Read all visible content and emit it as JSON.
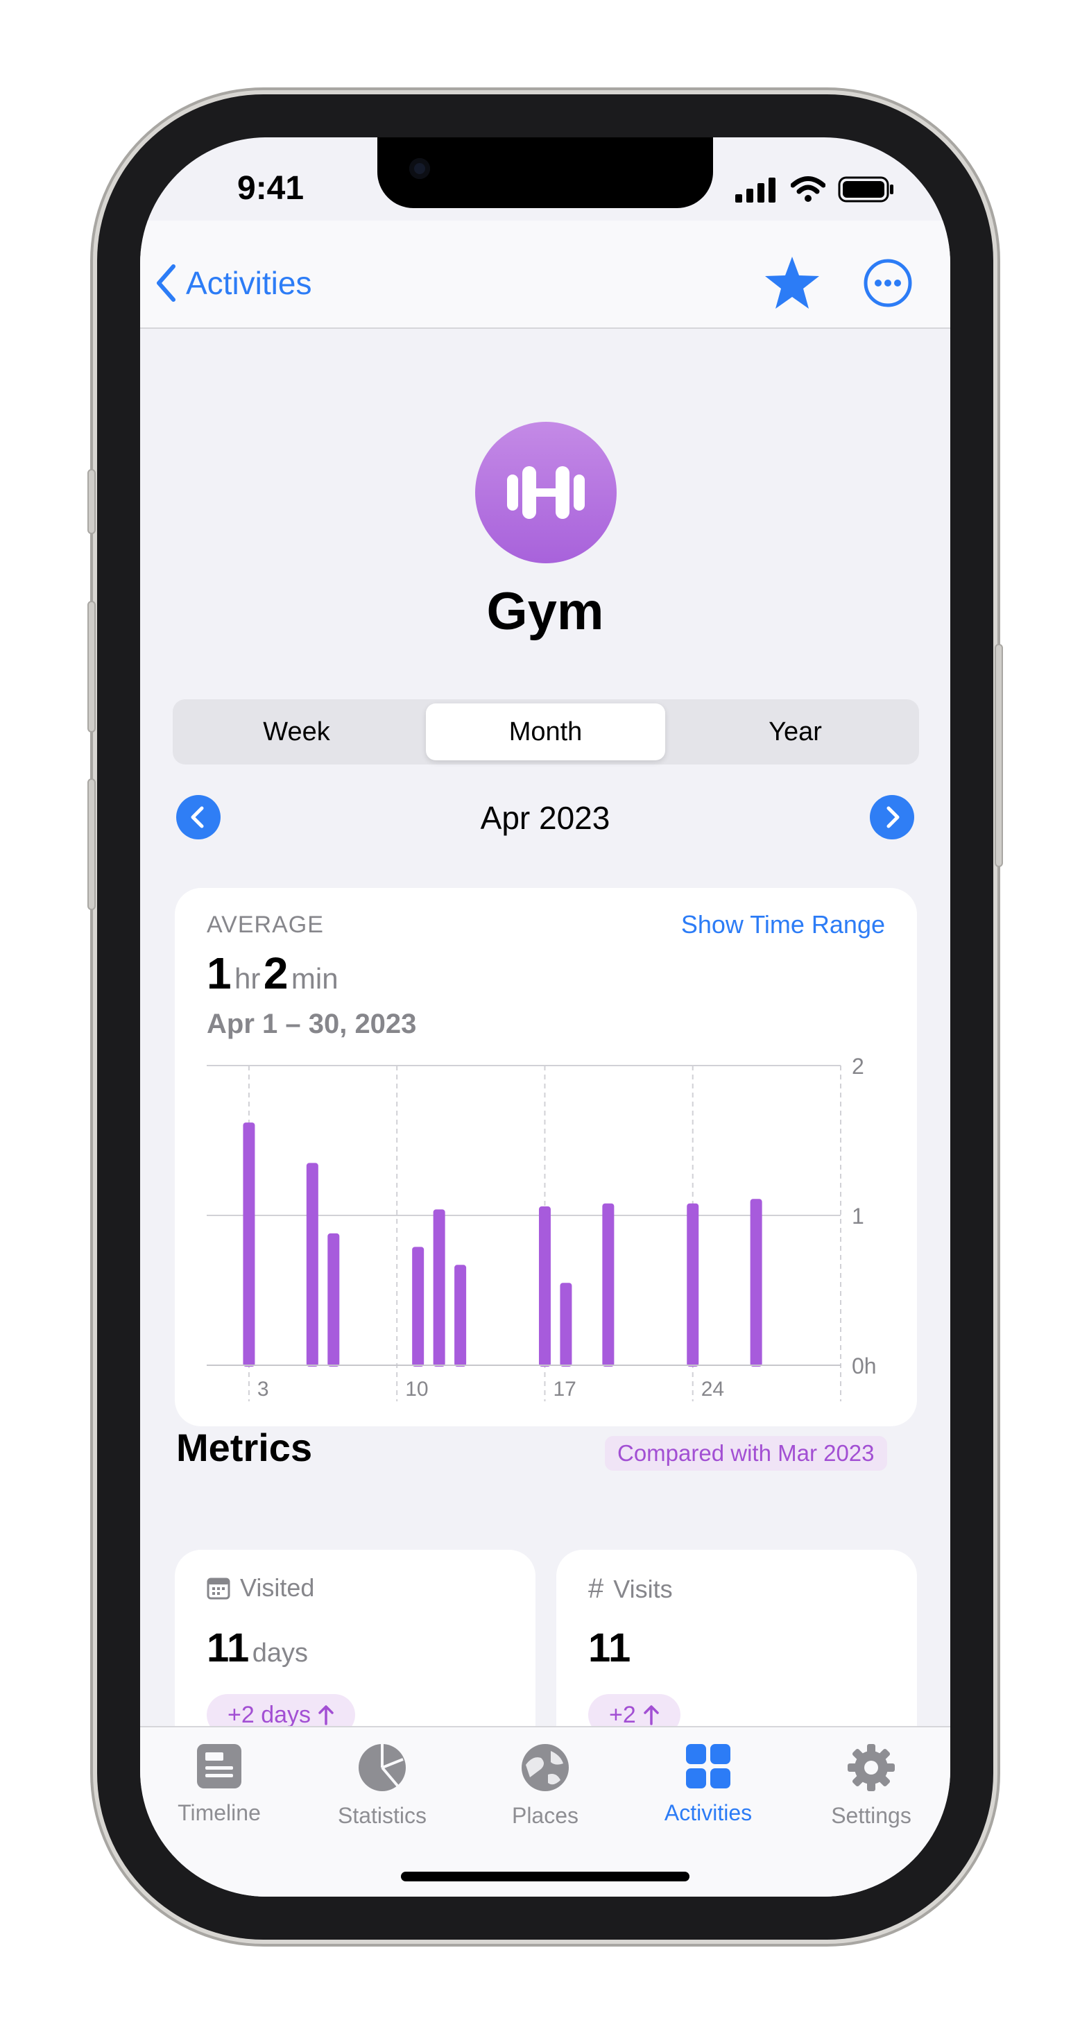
{
  "status_bar": {
    "time": "9:41"
  },
  "nav": {
    "back_label": "Activities"
  },
  "activity": {
    "title": "Gym"
  },
  "segments": [
    {
      "label": "Week",
      "active": false
    },
    {
      "label": "Month",
      "active": true
    },
    {
      "label": "Year",
      "active": false
    }
  ],
  "period": {
    "label": "Apr 2023"
  },
  "average": {
    "caption": "AVERAGE",
    "show_range_link": "Show Time Range",
    "hours": "1",
    "hours_unit": "hr",
    "minutes": "2",
    "minutes_unit": "min",
    "range": "Apr 1 – 30, 2023"
  },
  "chart_data": {
    "type": "bar",
    "x": [
      3,
      6,
      7,
      11,
      12,
      13,
      17,
      18,
      20,
      24,
      27
    ],
    "values": [
      1.62,
      1.35,
      0.88,
      0.79,
      1.04,
      0.67,
      1.06,
      0.55,
      1.08,
      1.08,
      1.11
    ],
    "xticks": [
      "3",
      "10",
      "17",
      "24"
    ],
    "ytick_labels": [
      "2",
      "1",
      "0h"
    ],
    "ylim": [
      0,
      2
    ],
    "xlim": [
      1,
      31
    ],
    "bar_color": "#a75bdc",
    "grid": true
  },
  "metrics": {
    "title": "Metrics",
    "compare_badge": "Compared with Mar 2023",
    "visited": {
      "label": "Visited",
      "value": "11",
      "unit": "days",
      "delta": "+2 days"
    },
    "visits": {
      "label": "Visits",
      "value": "11",
      "delta": "+2"
    }
  },
  "tabs": [
    {
      "label": "Timeline",
      "icon": "timeline-icon",
      "active": false
    },
    {
      "label": "Statistics",
      "icon": "statistics-icon",
      "active": false
    },
    {
      "label": "Places",
      "icon": "places-icon",
      "active": false
    },
    {
      "label": "Activities",
      "icon": "activities-icon",
      "active": true
    },
    {
      "label": "Settings",
      "icon": "settings-icon",
      "active": false
    }
  ],
  "colors": {
    "accent": "#2c7cf6",
    "purple": "#a75bdc",
    "background": "#f2f2f7"
  }
}
